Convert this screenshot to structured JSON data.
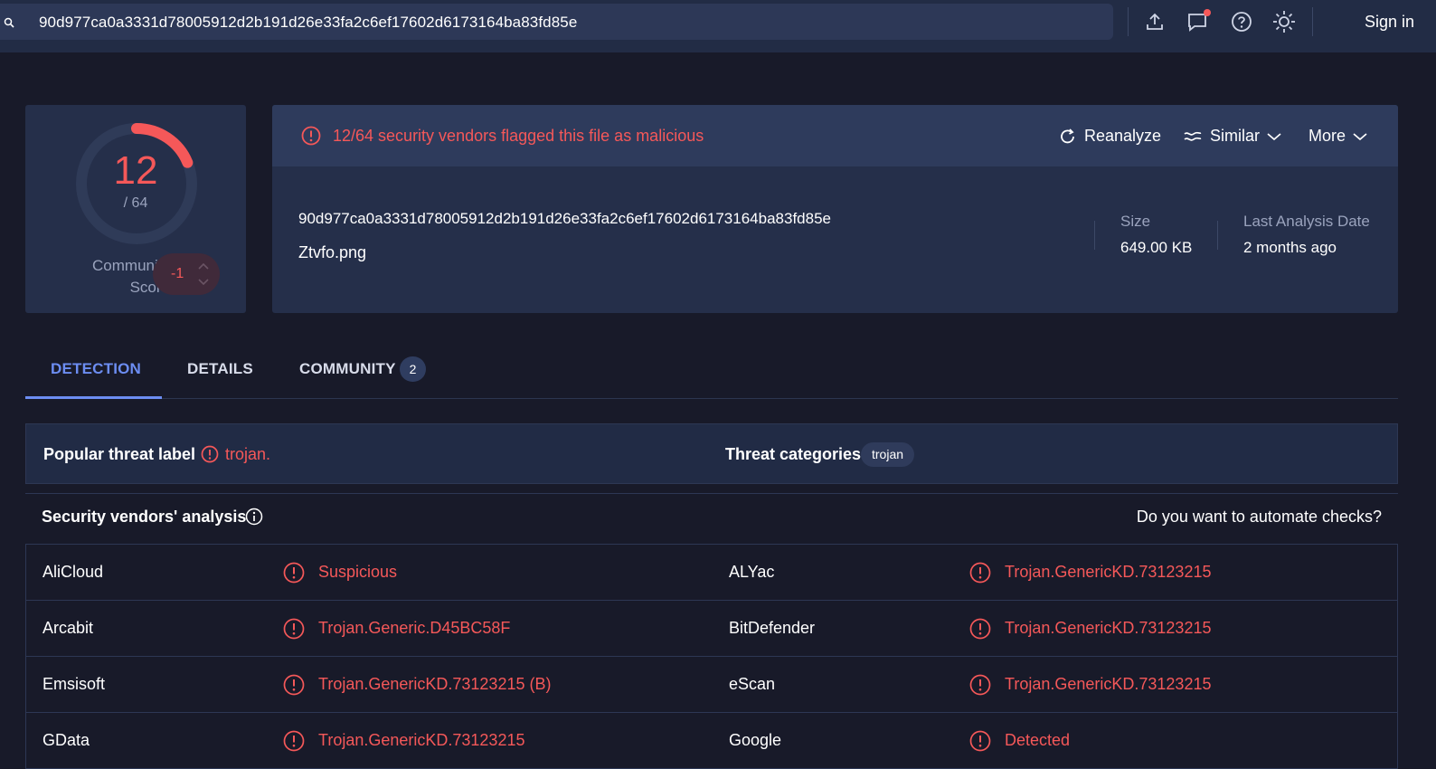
{
  "topbar": {
    "search_value": "90d977ca0a3331d78005912d2b191d26e33fa2c6ef17602d6173164ba83fd85e",
    "icons": [
      "upload-icon",
      "chat-icon",
      "help-icon",
      "theme-icon"
    ],
    "signin_label": "Sign in"
  },
  "score": {
    "detections": "12",
    "total": "/ 64",
    "detection_ratio": 0.1875,
    "community_label": "Community Score",
    "community_value": "-1"
  },
  "summary": {
    "alert": "12/64 security vendors flagged this file as malicious",
    "reanalyze_label": "Reanalyze",
    "similar_label": "Similar",
    "more_label": "More",
    "hash": "90d977ca0a3331d78005912d2b191d26e33fa2c6ef17602d6173164ba83fd85e",
    "filename": "Ztvfo.png",
    "size_label": "Size",
    "size_value": "649.00 KB",
    "date_label": "Last Analysis Date",
    "date_value": "2 months ago"
  },
  "tabs": [
    {
      "label": "DETECTION"
    },
    {
      "label": "DETAILS"
    },
    {
      "label": "COMMUNITY",
      "badge": "2"
    }
  ],
  "threat": {
    "label_title": "Popular threat label",
    "label_value": "trojan.",
    "categories_title": "Threat categories",
    "category": "trojan"
  },
  "vendors": {
    "title": "Security vendors' analysis",
    "automate": "Do you want to automate checks?",
    "rows": [
      [
        {
          "name": "AliCloud",
          "result": "Suspicious"
        },
        {
          "name": "ALYac",
          "result": "Trojan.GenericKD.73123215"
        }
      ],
      [
        {
          "name": "Arcabit",
          "result": "Trojan.Generic.D45BC58F"
        },
        {
          "name": "BitDefender",
          "result": "Trojan.GenericKD.73123215"
        }
      ],
      [
        {
          "name": "Emsisoft",
          "result": "Trojan.GenericKD.73123215 (B)"
        },
        {
          "name": "eScan",
          "result": "Trojan.GenericKD.73123215"
        }
      ],
      [
        {
          "name": "GData",
          "result": "Trojan.GenericKD.73123215"
        },
        {
          "name": "Google",
          "result": "Detected"
        }
      ]
    ]
  },
  "colors": {
    "accent": "#6c8df2",
    "malicious": "#f55859",
    "background": "#181a29",
    "card": "#252f4a"
  }
}
